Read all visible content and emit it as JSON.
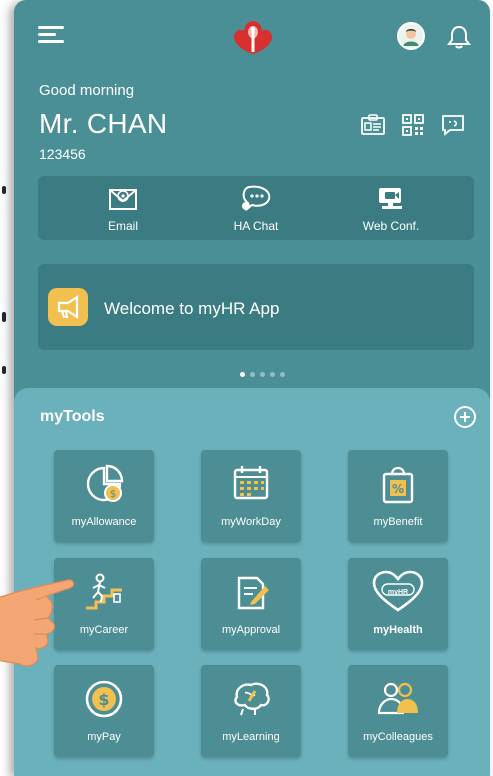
{
  "header": {
    "greeting": "Good morning",
    "name": "Mr. CHAN",
    "staff_id": "123456"
  },
  "quick_actions": [
    {
      "label": "Email",
      "icon": "mail-icon"
    },
    {
      "label": "HA Chat",
      "icon": "chat-icon"
    },
    {
      "label": "Web Conf.",
      "icon": "video-conference-icon"
    }
  ],
  "banner": {
    "text": "Welcome to myHR App",
    "icon": "megaphone-icon"
  },
  "carousel": {
    "total": 5,
    "active_index": 0
  },
  "tools": {
    "title": "myTools",
    "items": [
      {
        "label": "myAllowance",
        "icon": "allowance-icon"
      },
      {
        "label": "myWorkDay",
        "icon": "calendar-icon"
      },
      {
        "label": "myBenefit",
        "icon": "benefit-bag-icon"
      },
      {
        "label": "myCareer",
        "icon": "career-stairs-icon"
      },
      {
        "label": "myApproval",
        "icon": "approval-doc-icon"
      },
      {
        "label": "myHealth",
        "icon": "health-heart-icon",
        "heart_text": "myHR"
      },
      {
        "label": "myPay",
        "icon": "pay-coin-icon"
      },
      {
        "label": "myLearning",
        "icon": "learning-brain-icon"
      },
      {
        "label": "myColleagues",
        "icon": "colleagues-icon"
      }
    ]
  },
  "colors": {
    "app_background": "#4a8f95",
    "card_background": "#3b7c82",
    "tools_panel": "#6ab1bc",
    "tile_background": "#4d8d94",
    "accent_yellow": "#f2c04e",
    "logo_red": "#d8302f"
  }
}
